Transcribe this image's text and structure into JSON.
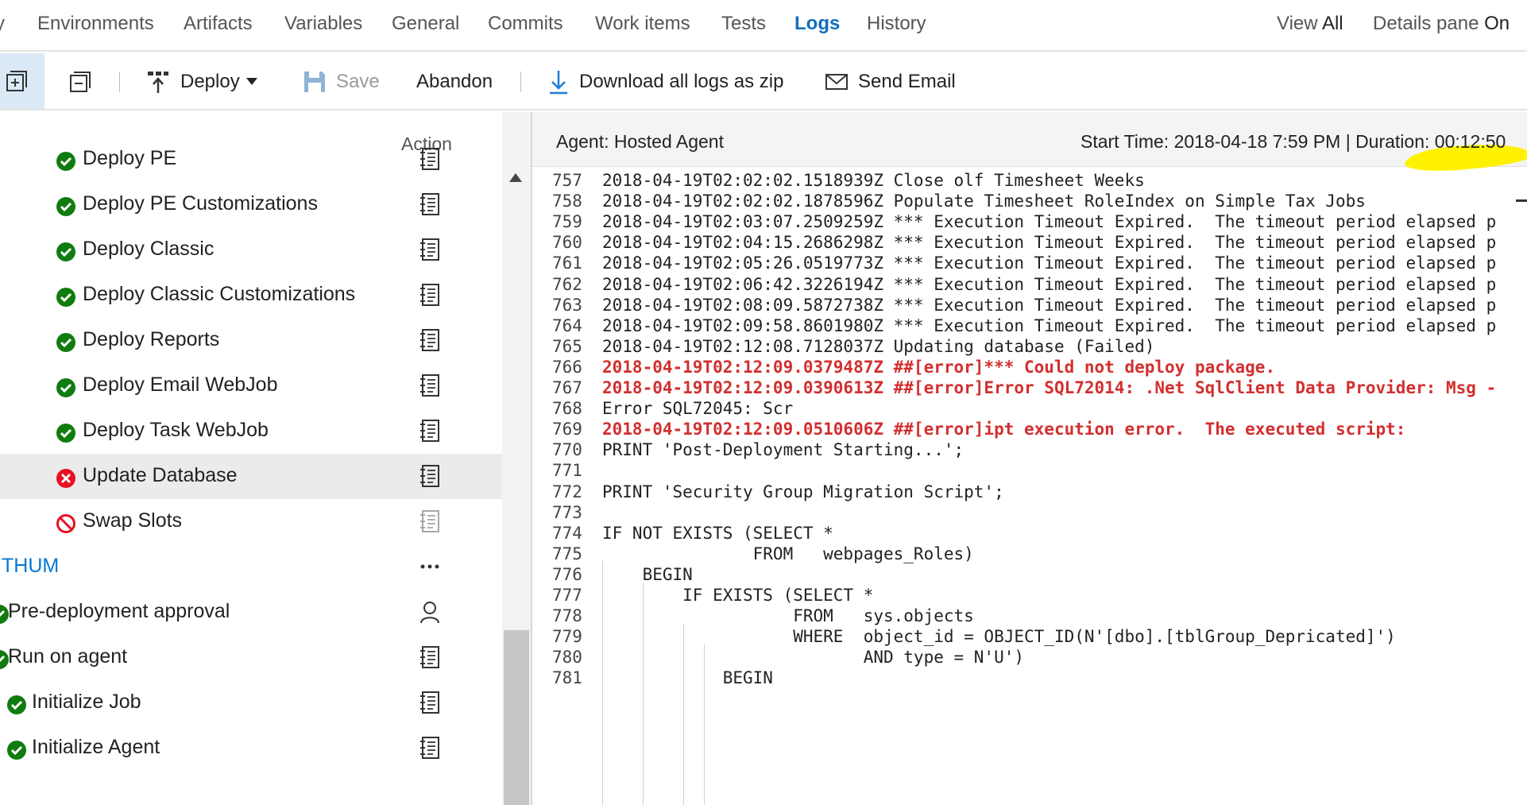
{
  "nav": {
    "tabs": [
      {
        "label": "Environments",
        "active": false
      },
      {
        "label": "Artifacts",
        "active": false
      },
      {
        "label": "Variables",
        "active": false
      },
      {
        "label": "General",
        "active": false
      },
      {
        "label": "Commits",
        "active": false
      },
      {
        "label": "Work items",
        "active": false
      },
      {
        "label": "Tests",
        "active": false
      },
      {
        "label": "Logs",
        "active": true
      },
      {
        "label": "History",
        "active": false
      }
    ],
    "view_label": "View",
    "view_value": "All",
    "details_label": "Details pane",
    "details_value": "On"
  },
  "toolbar": {
    "deploy": "Deploy",
    "save": "Save",
    "abandon": "Abandon",
    "download": "Download all logs as zip",
    "email": "Send Email"
  },
  "steps_panel": {
    "action_header": "Action",
    "steps": [
      {
        "label": "Deploy PE",
        "status": "success",
        "action": "log"
      },
      {
        "label": "Deploy PE Customizations",
        "status": "success",
        "action": "log"
      },
      {
        "label": "Deploy Classic",
        "status": "success",
        "action": "log"
      },
      {
        "label": "Deploy Classic Customizations",
        "status": "success",
        "action": "log"
      },
      {
        "label": "Deploy Reports",
        "status": "success",
        "action": "log"
      },
      {
        "label": "Deploy Email WebJob",
        "status": "success",
        "action": "log"
      },
      {
        "label": "Deploy Task WebJob",
        "status": "success",
        "action": "log"
      },
      {
        "label": "Update Database",
        "status": "failed",
        "action": "log",
        "selected": true
      },
      {
        "label": "Swap Slots",
        "status": "canceled",
        "action": "log-disabled"
      },
      {
        "label": "THUM",
        "status": "group",
        "action": "more"
      },
      {
        "label": "Pre-deployment approval",
        "status": "partial",
        "action": "person"
      },
      {
        "label": "Run on agent",
        "status": "partial",
        "action": "log"
      },
      {
        "label": "Initialize Job",
        "status": "success",
        "action": "log"
      },
      {
        "label": "Initialize Agent",
        "status": "success",
        "action": "log"
      }
    ]
  },
  "log": {
    "agent": "Agent: Hosted Agent",
    "start_label": "Start Time:",
    "start_value": "2018-04-18 7:59 PM",
    "duration_label": "Duration:",
    "duration_value": "00:12:50",
    "lines": [
      {
        "n": "757",
        "text": "2018-04-19T02:02:02.1518939Z Close olf Timesheet Weeks",
        "error": false
      },
      {
        "n": "758",
        "text": "2018-04-19T02:02:02.1878596Z Populate Timesheet RoleIndex on Simple Tax Jobs",
        "error": false
      },
      {
        "n": "759",
        "text": "2018-04-19T02:03:07.2509259Z *** Execution Timeout Expired.  The timeout period elapsed p",
        "error": false
      },
      {
        "n": "760",
        "text": "2018-04-19T02:04:15.2686298Z *** Execution Timeout Expired.  The timeout period elapsed p",
        "error": false
      },
      {
        "n": "761",
        "text": "2018-04-19T02:05:26.0519773Z *** Execution Timeout Expired.  The timeout period elapsed p",
        "error": false
      },
      {
        "n": "762",
        "text": "2018-04-19T02:06:42.3226194Z *** Execution Timeout Expired.  The timeout period elapsed p",
        "error": false
      },
      {
        "n": "763",
        "text": "2018-04-19T02:08:09.5872738Z *** Execution Timeout Expired.  The timeout period elapsed p",
        "error": false
      },
      {
        "n": "764",
        "text": "2018-04-19T02:09:58.8601980Z *** Execution Timeout Expired.  The timeout period elapsed p",
        "error": false
      },
      {
        "n": "765",
        "text": "2018-04-19T02:12:08.7128037Z Updating database (Failed)",
        "error": false
      },
      {
        "n": "766",
        "text": "2018-04-19T02:12:09.0379487Z ##[error]*** Could not deploy package.",
        "error": true
      },
      {
        "n": "767",
        "text": "2018-04-19T02:12:09.0390613Z ##[error]Error SQL72014: .Net SqlClient Data Provider: Msg -",
        "error": true
      },
      {
        "n": "768",
        "text": "Error SQL72045: Scr",
        "error": false
      },
      {
        "n": "769",
        "text": "2018-04-19T02:12:09.0510606Z ##[error]ipt execution error.  The executed script:",
        "error": true
      },
      {
        "n": "770",
        "text": "PRINT 'Post-Deployment Starting...';",
        "error": false
      },
      {
        "n": "771",
        "text": "",
        "error": false
      },
      {
        "n": "772",
        "text": "PRINT 'Security Group Migration Script';",
        "error": false
      },
      {
        "n": "773",
        "text": "",
        "error": false
      },
      {
        "n": "774",
        "text": "IF NOT EXISTS (SELECT *",
        "error": false
      },
      {
        "n": "775",
        "text": "               FROM   webpages_Roles)",
        "error": false
      },
      {
        "n": "776",
        "text": "    BEGIN",
        "error": false
      },
      {
        "n": "777",
        "text": "        IF EXISTS (SELECT *",
        "error": false
      },
      {
        "n": "778",
        "text": "                   FROM   sys.objects",
        "error": false
      },
      {
        "n": "779",
        "text": "                   WHERE  object_id = OBJECT_ID(N'[dbo].[tblGroup_Depricated]')",
        "error": false
      },
      {
        "n": "780",
        "text": "                          AND type = N'U')",
        "error": false
      },
      {
        "n": "781",
        "text": "            BEGIN",
        "error": false
      }
    ]
  }
}
